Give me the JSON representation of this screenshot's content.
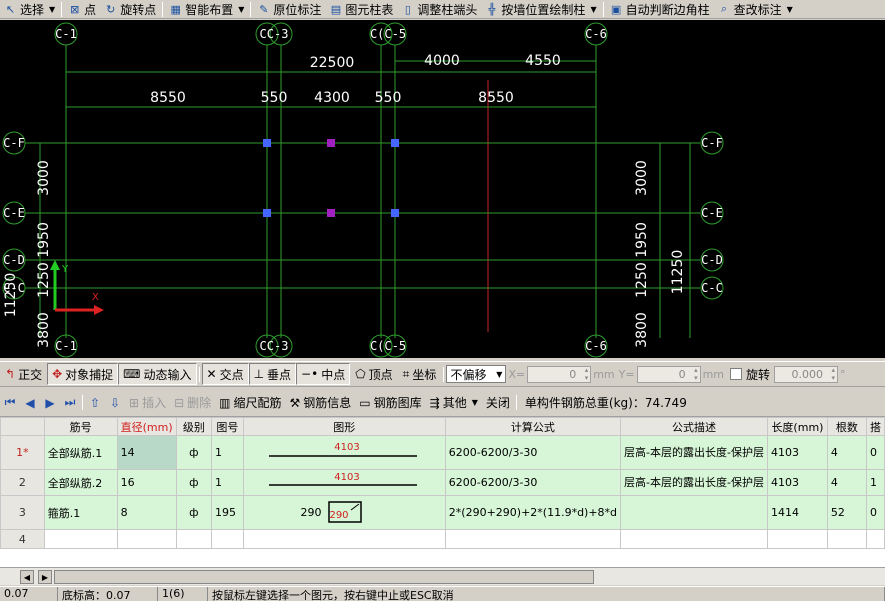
{
  "top_toolbar": {
    "select": "选择",
    "point": "点",
    "rotate_point": "旋转点",
    "smart_layout": "智能布置",
    "in_place_label": "原位标注",
    "column_table": "图元柱表",
    "adjust_column_end": "调整柱端头",
    "draw_by_wall": "按墙位置绘制柱",
    "auto_corner": "自动判断边角柱",
    "check_label": "查改标注"
  },
  "cad": {
    "axes_top": [
      "C-1",
      "C-2",
      "C-3",
      "C-4",
      "C-5",
      "C-6"
    ],
    "axes_top_labels": [
      "C-1",
      "CC-3",
      "C(C-5",
      "C-6"
    ],
    "axes_left": [
      "C-F",
      "C-E",
      "C-D",
      "C-C"
    ],
    "dims_top_row1": [
      "22500",
      "4000",
      "4550"
    ],
    "dims_top_row2": [
      "8550",
      "550",
      "4300",
      "550",
      "8550"
    ],
    "dims_left": [
      "3000",
      "1250 1950",
      "11250",
      "3800"
    ],
    "dims_right": [
      "3000",
      "1250 1950",
      "11250",
      "3800"
    ],
    "left_partial": [
      "C-F",
      "C-E",
      "C-D",
      "C-C"
    ],
    "right_partial": [
      "C-F",
      "C-E",
      "C-D",
      "C-C"
    ],
    "colors": {
      "grid": "#cc2222",
      "dim": "#2e9e2e",
      "text": "#ffffff",
      "blue_marker": "#4466ff",
      "purple_marker": "#a020c0"
    }
  },
  "snap_toolbar": {
    "ortho": "正交",
    "object_snap": "对象捕捉",
    "dynamic_input": "动态输入",
    "intersection": "交点",
    "perpendicular": "垂点",
    "midpoint": "中点",
    "vertex": "顶点",
    "coordinate": "坐标",
    "offset_mode": "不偏移",
    "x_label": "X=",
    "x_value": "0",
    "y_label": "Y=",
    "y_value": "0",
    "unit_mm": "mm",
    "rotate_label": "旋转",
    "rotate_value": "0.000",
    "degree": "°"
  },
  "rebar_toolbar": {
    "insert": "插入",
    "delete": "删除",
    "scale_rebar": "缩尺配筋",
    "rebar_info": "钢筋信息",
    "rebar_library": "钢筋图库",
    "other": "其他",
    "close": "关闭",
    "total_weight": "单构件钢筋总重(kg)：74.749"
  },
  "table": {
    "headers": [
      "",
      "筋号",
      "直径(mm)",
      "级别",
      "图号",
      "图形",
      "计算公式",
      "公式描述",
      "长度(mm)",
      "根数",
      "搭"
    ],
    "rows": [
      {
        "num": "1*",
        "name": "全部纵筋.1",
        "dia": "14",
        "grade": "ф",
        "fig_no": "1",
        "shape_value": "4103",
        "formula": "6200-6200/3-30",
        "desc": "层高-本层的露出长度-保护层",
        "length": "4103",
        "count": "4",
        "lap": "0"
      },
      {
        "num": "2",
        "name": "全部纵筋.2",
        "dia": "16",
        "grade": "ф",
        "fig_no": "1",
        "shape_value": "4103",
        "formula": "6200-6200/3-30",
        "desc": "层高-本层的露出长度-保护层",
        "length": "4103",
        "count": "4",
        "lap": "1"
      },
      {
        "num": "3",
        "name": "箍筋.1",
        "dia": "8",
        "grade": "ф",
        "fig_no": "195",
        "shape_left": "290",
        "shape_value": "290",
        "formula": "2*(290+290)+2*(11.9*d)+8*d",
        "desc": "",
        "length": "1414",
        "count": "52",
        "lap": "0"
      },
      {
        "num": "4",
        "name": "",
        "dia": "",
        "grade": "",
        "fig_no": "",
        "shape_value": "",
        "formula": "",
        "desc": "",
        "length": "",
        "count": "",
        "lap": ""
      }
    ]
  },
  "status": {
    "s1": "0.07",
    "s2": "底标高：0.07",
    "s3": "1(6)",
    "s4": "按鼠标左键选择一个图元，按右键中止或ESC取消"
  }
}
